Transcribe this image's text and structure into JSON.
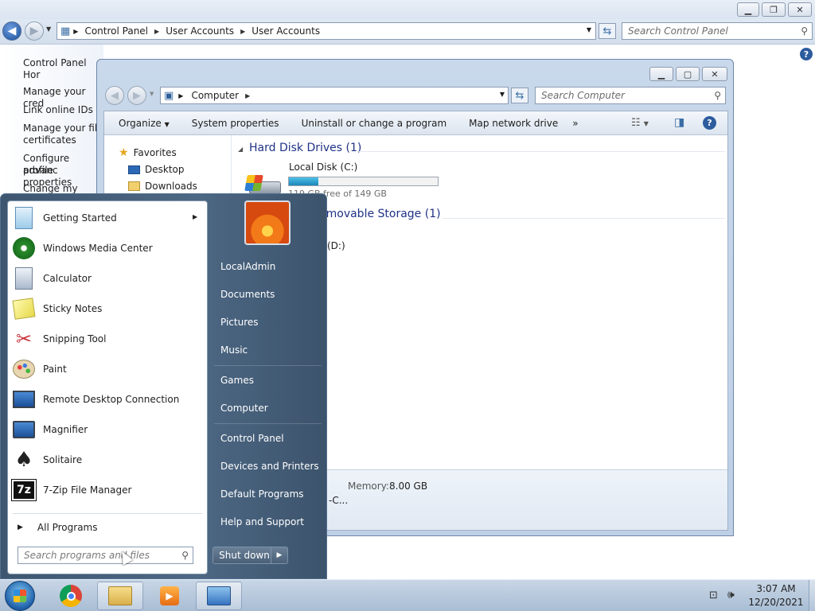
{
  "control_panel": {
    "breadcrumb": [
      "Control Panel",
      "User Accounts",
      "User Accounts"
    ],
    "search_placeholder": "Search Control Panel",
    "left_links": [
      "Control Panel Hor",
      "Manage your cred",
      "Link online IDs",
      "Manage your file",
      "certificates",
      "Configure advanc",
      "profile properties",
      "Change my enviro"
    ]
  },
  "computer_window": {
    "breadcrumb": [
      "Computer"
    ],
    "search_placeholder": "Search Computer",
    "toolbar": {
      "organize": "Organize",
      "system_properties": "System properties",
      "uninstall": "Uninstall or change a program",
      "map_drive": "Map network drive",
      "more": "»"
    },
    "nav": {
      "favorites": "Favorites",
      "desktop": "Desktop",
      "downloads": "Downloads"
    },
    "groups": {
      "hard_disks": "Hard Disk Drives (1)",
      "removable": "Devices with Removable Storage (1)",
      "removable_visible": "emovable Storage (1)"
    },
    "local_disk": {
      "name": "Local Disk (C:)",
      "free_text": "119 GB free of 149 GB",
      "used_fraction": 0.2
    },
    "dvd_label": "(D:)",
    "details": {
      "memory_label": "Memory:",
      "memory_value": "8.00 GB",
      "partial_text": "-C..."
    }
  },
  "start_menu": {
    "programs": [
      {
        "label": "Getting Started",
        "icon": "getting-started-icon",
        "submenu": true
      },
      {
        "label": "Windows Media Center",
        "icon": "media-center-icon"
      },
      {
        "label": "Calculator",
        "icon": "calculator-icon"
      },
      {
        "label": "Sticky Notes",
        "icon": "sticky-notes-icon"
      },
      {
        "label": "Snipping Tool",
        "icon": "scissors-icon"
      },
      {
        "label": "Paint",
        "icon": "paint-palette-icon"
      },
      {
        "label": "Remote Desktop Connection",
        "icon": "remote-desktop-icon"
      },
      {
        "label": "Magnifier",
        "icon": "magnifier-icon"
      },
      {
        "label": "Solitaire",
        "icon": "playing-card-icon"
      },
      {
        "label": "7-Zip File Manager",
        "icon": "7zip-icon"
      }
    ],
    "all_programs": "All Programs",
    "search_placeholder": "Search programs and files",
    "right_items": [
      "LocalAdmin",
      "Documents",
      "Pictures",
      "Music",
      "Games",
      "Computer",
      "Control Panel",
      "Devices and Printers",
      "Default Programs",
      "Help and Support"
    ],
    "shutdown": "Shut down",
    "shutdown_arrow": "▶"
  },
  "taskbar": {
    "time": "3:07 AM",
    "date": "12/20/2021",
    "items": [
      "start-orb-icon",
      "chrome-icon",
      "explorer-icon",
      "media-player-icon",
      "control-panel-icon"
    ]
  },
  "colors": {
    "accent": "#1e3287",
    "start_menu_bg": "#4d6884",
    "taskbar_bg": "#b9cadf",
    "progress_fill": "#2a9fc9"
  }
}
